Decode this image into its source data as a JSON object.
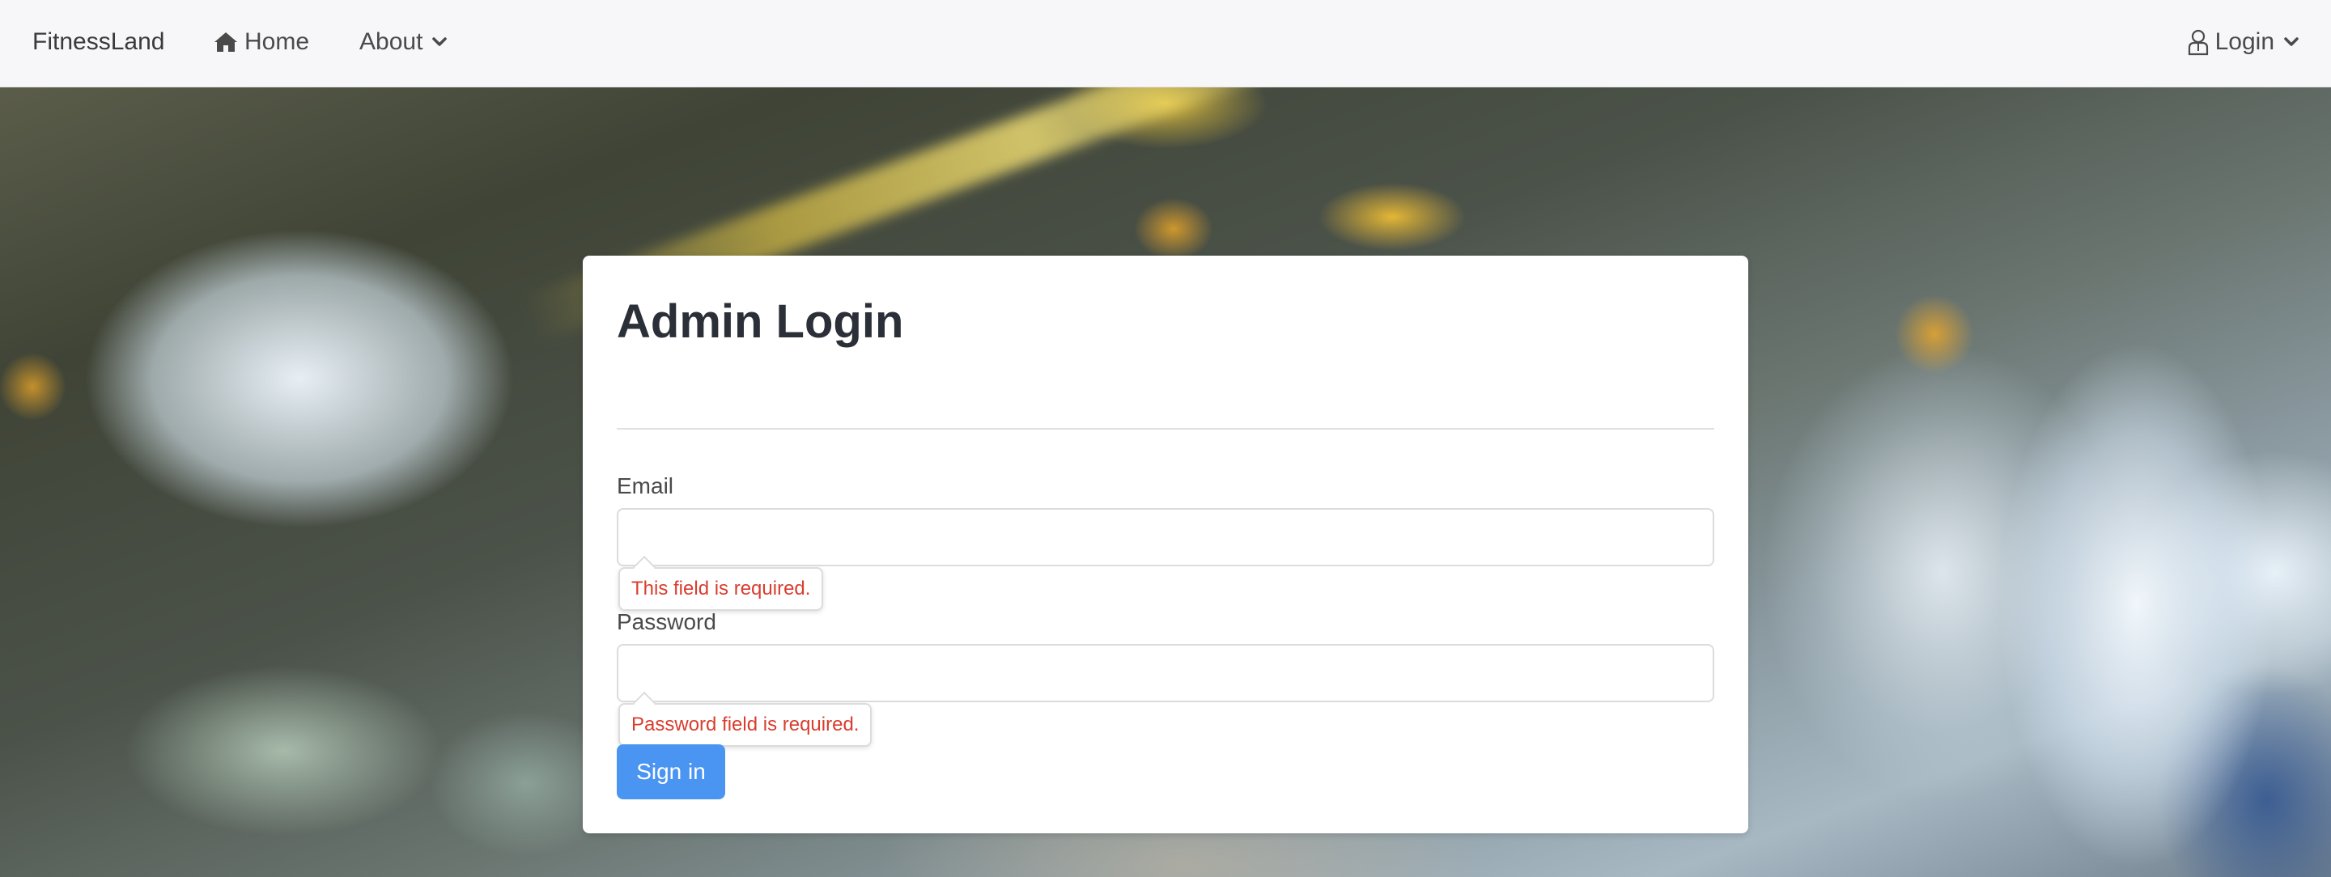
{
  "navbar": {
    "brand": "FitnessLand",
    "home_label": "Home",
    "about_label": "About",
    "login_label": "Login",
    "icons": {
      "home": "home-icon",
      "about_caret": "chevron-down-icon",
      "user": "user-icon",
      "login_caret": "chevron-down-icon"
    }
  },
  "login_form": {
    "title": "Admin Login",
    "email_label": "Email",
    "email_value": "",
    "email_error": "This field is required.",
    "password_label": "Password",
    "password_value": "",
    "password_error": "Password field is required.",
    "submit_label": "Sign in"
  },
  "colors": {
    "primary_button": "#4a94f2",
    "error_text": "#d93d2e",
    "title_text": "#2b2f38",
    "navbar_bg": "#f7f7f9"
  }
}
